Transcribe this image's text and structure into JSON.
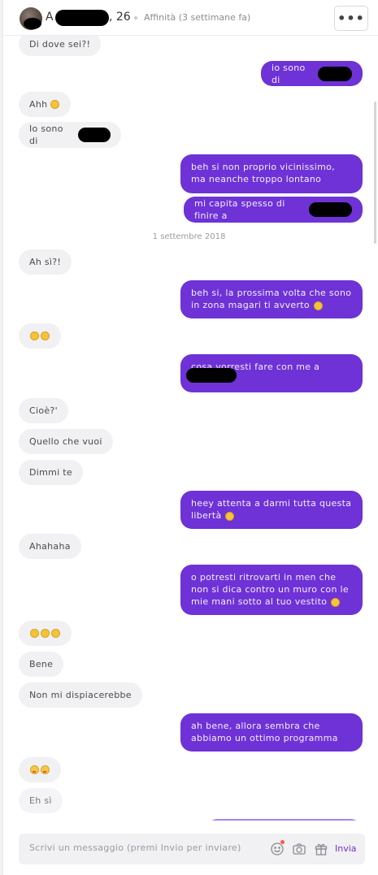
{
  "header": {
    "name_initial": "A",
    "name_age": ", 26",
    "affinity": "Affinità (3 settimane fa)",
    "more_label": "•••"
  },
  "date_separator": "1 settembre 2018",
  "messages": [
    {
      "dir": "in",
      "text": "Di dove sei?!"
    },
    {
      "dir": "out",
      "text": "io sono di",
      "redacted": true
    },
    {
      "dir": "in",
      "text": "Ahh",
      "emoji": "smile"
    },
    {
      "dir": "in",
      "text": "Io sono di",
      "redacted": true
    },
    {
      "dir": "out",
      "text": "beh si non proprio vicinissimo, ma neanche troppo lontano"
    },
    {
      "dir": "out",
      "text": "mi capita spesso di finire a",
      "redacted": true
    },
    {
      "dir": "in",
      "text": "Ah sì?!"
    },
    {
      "dir": "out",
      "text": "beh si, la prossima volta che sono in zona magari ti avverto",
      "emoji": "smile"
    },
    {
      "dir": "in",
      "text": "",
      "emoji": "smile-smile"
    },
    {
      "dir": "out",
      "text": "cosa vorresti fare con me a",
      "redacted": true
    },
    {
      "dir": "in",
      "text": "Cioè?'"
    },
    {
      "dir": "in",
      "text": "Quello che vuoi"
    },
    {
      "dir": "in",
      "text": "Dimmi te"
    },
    {
      "dir": "out",
      "text": "heey attenta a darmi tutta questa libertà",
      "emoji": "grin"
    },
    {
      "dir": "in",
      "text": "Ahahaha"
    },
    {
      "dir": "out",
      "text": "o potresti ritrovarti in men che non si dica contro un muro con le mie mani sotto al tuo vestito",
      "emoji": "wink"
    },
    {
      "dir": "in",
      "text": "",
      "emoji": "grin-grin-grin"
    },
    {
      "dir": "in",
      "text": "Bene"
    },
    {
      "dir": "in",
      "text": "Non mi dispiacerebbe"
    },
    {
      "dir": "out",
      "text": "ah bene, allora sembra che abbiamo un ottimo programma"
    },
    {
      "dir": "in",
      "text": "",
      "emoji": "kiss-kiss"
    },
    {
      "dir": "in",
      "text": "Eh sì"
    }
  ],
  "composer": {
    "placeholder": "Scrivi un messaggio (premi Invio per inviare)",
    "send_label": "Invia",
    "icons": [
      "emoji-icon",
      "camera-icon",
      "gift-icon"
    ]
  },
  "colors": {
    "outgoing_bubble": "#6e32d7",
    "incoming_bubble": "#f1f0f3",
    "accent": "#6e32d7"
  }
}
